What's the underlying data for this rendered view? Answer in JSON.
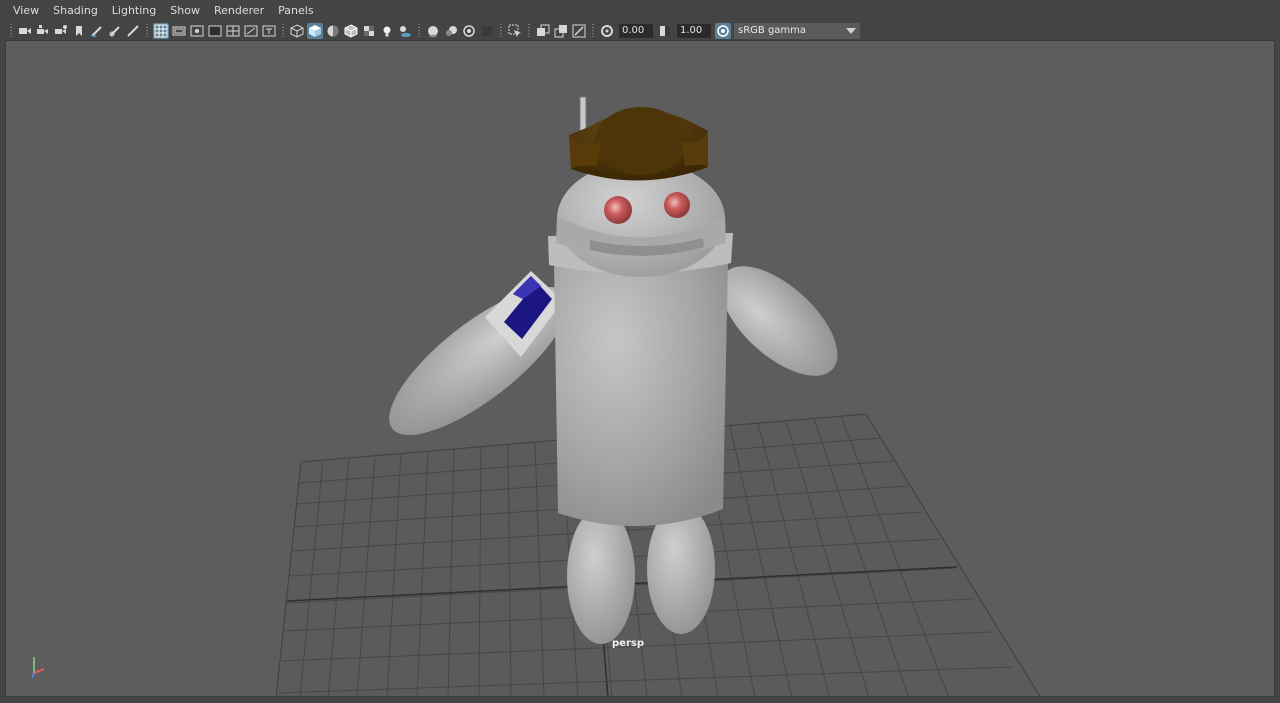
{
  "menu": {
    "items": [
      {
        "label": "View"
      },
      {
        "label": "Shading"
      },
      {
        "label": "Lighting"
      },
      {
        "label": "Show"
      },
      {
        "label": "Renderer"
      },
      {
        "label": "Panels"
      }
    ]
  },
  "toolbar": {
    "exposure_value": "0.00",
    "gamma_value": "1.00",
    "color_space": "sRGB gamma",
    "accent_color": "#5b7f96"
  },
  "viewport": {
    "camera_label": "persp",
    "background_color": "#5d5d5d"
  }
}
